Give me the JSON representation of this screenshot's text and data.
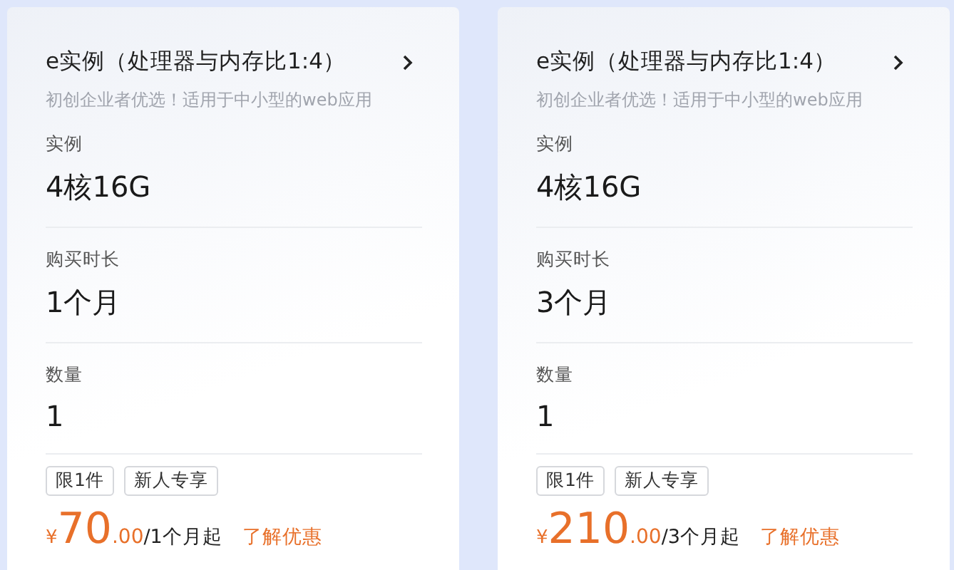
{
  "cards": [
    {
      "title": "e实例（处理器与内存比1:4）",
      "subtitle": "初创企业者优选！适用于中小型的web应用",
      "fields": [
        {
          "label": "实例",
          "value": "4核16G"
        },
        {
          "label": "购买时长",
          "value": "1个月"
        },
        {
          "label": "数量",
          "value": "1"
        }
      ],
      "tags": [
        "限1件",
        "新人专享"
      ],
      "price": {
        "currency": "¥",
        "integer": "70",
        "decimal": ".00",
        "unit": "/1个月起",
        "link": "了解优惠"
      }
    },
    {
      "title": "e实例（处理器与内存比1:4）",
      "subtitle": "初创企业者优选！适用于中小型的web应用",
      "fields": [
        {
          "label": "实例",
          "value": "4核16G"
        },
        {
          "label": "购买时长",
          "value": "3个月"
        },
        {
          "label": "数量",
          "value": "1"
        }
      ],
      "tags": [
        "限1件",
        "新人专享"
      ],
      "price": {
        "currency": "¥",
        "integer": "210",
        "decimal": ".00",
        "unit": "/3个月起",
        "link": "了解优惠"
      }
    }
  ]
}
